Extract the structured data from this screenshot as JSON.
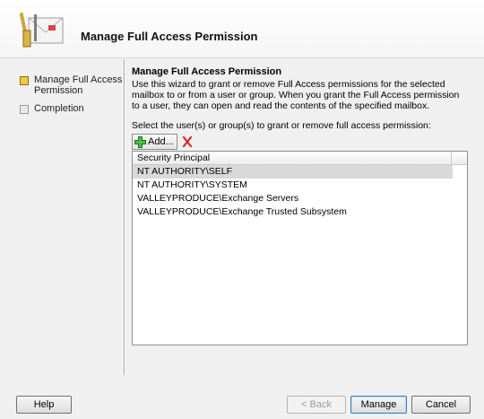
{
  "header": {
    "title": "Manage Full Access Permission",
    "icon": "mailbox-wizard-icon"
  },
  "nav": {
    "steps": [
      {
        "label": "Manage Full Access Permission",
        "state": "active"
      },
      {
        "label": "Completion",
        "state": "inactive"
      }
    ]
  },
  "content": {
    "title": "Manage Full Access Permission",
    "description": "Use this wizard to grant or remove Full Access permissions for the selected mailbox to or from a user or group. When you grant the Full Access permission to a user, they can open and read the contents of the specified mailbox.",
    "select_label": "Select the user(s) or group(s) to grant or remove full access permission:",
    "add_label": "Add...",
    "add_icon": "green-plus-icon",
    "remove_icon": "red-x-icon"
  },
  "list": {
    "column": "Security Principal",
    "rows": [
      {
        "value": "NT AUTHORITY\\SELF",
        "selected": true
      },
      {
        "value": "NT AUTHORITY\\SYSTEM",
        "selected": false
      },
      {
        "value": "VALLEYPRODUCE\\Exchange Servers",
        "selected": false
      },
      {
        "value": "VALLEYPRODUCE\\Exchange Trusted Subsystem",
        "selected": false
      }
    ]
  },
  "buttons": {
    "help": "Help",
    "back": "< Back",
    "manage": "Manage",
    "cancel": "Cancel"
  },
  "colors": {
    "active_step": "#f2c94c",
    "selected_row": "#d9d9d9",
    "add_icon": "#3aa335",
    "remove_icon": "#d42a2a"
  }
}
